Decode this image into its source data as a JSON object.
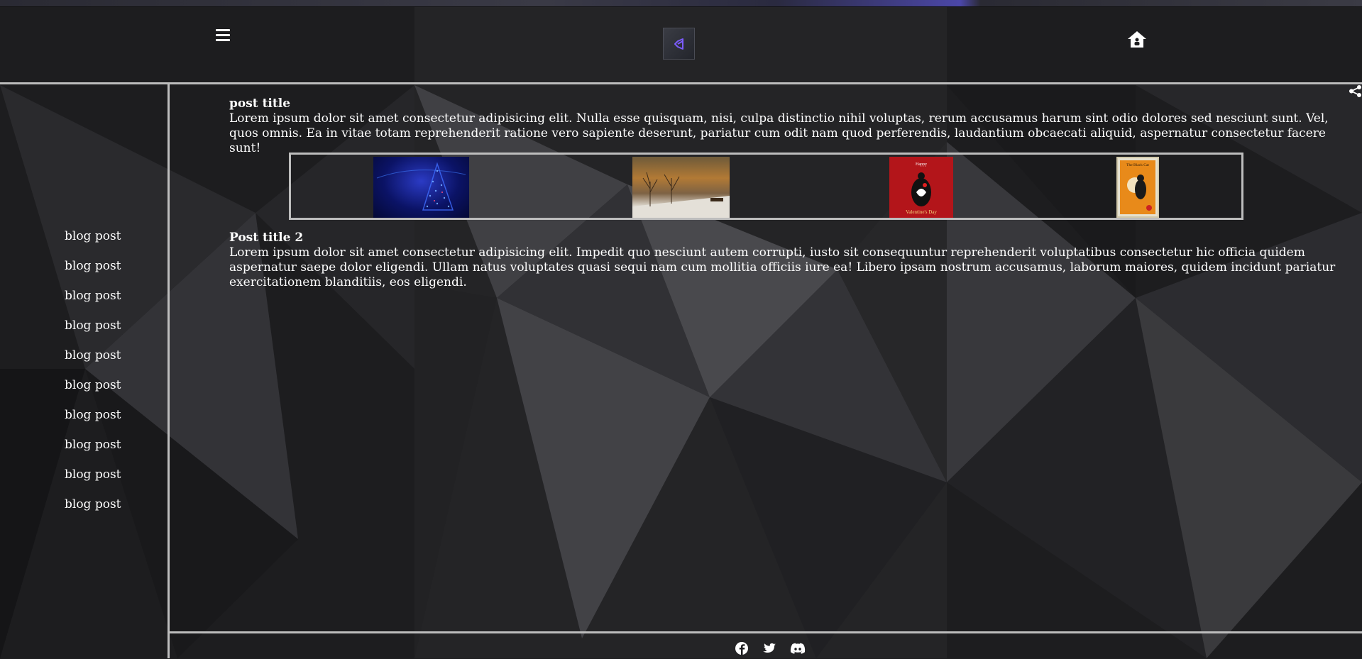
{
  "header": {
    "menu_icon": "hamburger-icon",
    "logo_icon": "visual-studio-logo-icon",
    "home_icon": "home-icon"
  },
  "sidebar": {
    "items": [
      {
        "label": "blog post"
      },
      {
        "label": "blog post"
      },
      {
        "label": "blog post"
      },
      {
        "label": "blog post"
      },
      {
        "label": "blog post"
      },
      {
        "label": "blog post"
      },
      {
        "label": "blog post"
      },
      {
        "label": "blog post"
      },
      {
        "label": "blog post"
      },
      {
        "label": "blog post"
      }
    ]
  },
  "posts": [
    {
      "title": "post title",
      "body": "Lorem ipsum dolor sit amet consectetur adipisicing elit. Nulla esse quisquam, nisi, culpa distinctio nihil voluptas, rerum accusamus harum sint odio dolores sed nesciunt sunt. Vel, quos omnis. Ea in vitae totam reprehenderit ratione vero sapiente deserunt, pariatur cum odit nam quod perferendis, laudantium obcaecati aliquid, aspernatur consectetur facere sunt!"
    },
    {
      "title": "Post title 2",
      "body": "Lorem ipsum dolor sit amet consectetur adipisicing elit. Impedit quo nesciunt autem corrupti, iusto sit consequuntur reprehenderit voluptatibus consectetur hic officia quidem aspernatur saepe dolor eligendi. Ullam natus voluptates quasi sequi nam cum mollitia officiis iure ea! Libero ipsam nostrum accusamus, laborum maiores, quidem incidunt pariatur exercitationem blanditiis, eos eligendi."
    }
  ],
  "gallery": {
    "thumbnails": [
      {
        "name": "christmas-tree-image"
      },
      {
        "name": "autumn-forest-image"
      },
      {
        "name": "valentines-day-card-image",
        "caption": "Valentine's Day",
        "top_text": "Happy"
      },
      {
        "name": "vintage-poster-image",
        "top_text": "The Black Cat"
      }
    ]
  },
  "share_icon": "share-icon",
  "footer": {
    "icons": [
      "facebook-icon",
      "twitter-icon",
      "discord-icon"
    ]
  },
  "colors": {
    "background": "#1e1e20",
    "divider": "#bdbdbd",
    "text": "#ffffff",
    "accent": "#6d4cff"
  }
}
